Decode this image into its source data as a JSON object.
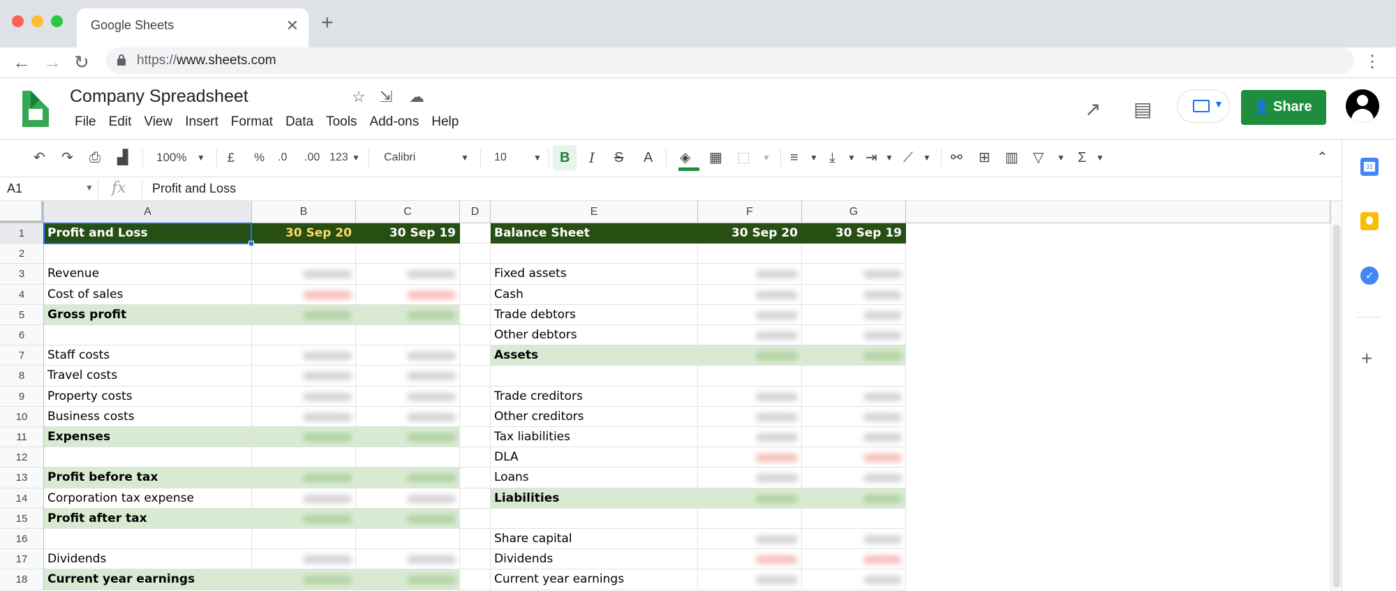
{
  "browser": {
    "tab_title": "Google Sheets",
    "url_scheme": "https://",
    "url_host": "www.sheets.com"
  },
  "doc": {
    "title": "Company Spreadsheet",
    "menu": [
      "File",
      "Edit",
      "View",
      "Insert",
      "Format",
      "Data",
      "Tools",
      "Add-ons",
      "Help"
    ],
    "share_label": "Share"
  },
  "toolbar": {
    "zoom": "100%",
    "currency": "£",
    "percent": "%",
    "dec_less": ".0",
    "dec_more": ".00",
    "number_format": "123",
    "font": "Calibri",
    "font_size": "10"
  },
  "formula_bar": {
    "cell_ref": "A1",
    "content": "Profit and Loss"
  },
  "side_panel": {
    "calendar_day": "31"
  },
  "grid": {
    "columns": [
      "A",
      "B",
      "C",
      "D",
      "E",
      "F",
      "G"
    ],
    "row_numbers": [
      "1",
      "2",
      "3",
      "4",
      "5",
      "6",
      "7",
      "8",
      "9",
      "10",
      "11",
      "12",
      "13",
      "14",
      "15",
      "16",
      "17",
      "18"
    ],
    "pl": {
      "header": "Profit and Loss",
      "col_b": "30 Sep 20",
      "col_c": "30 Sep 19",
      "rows": [
        "",
        "Revenue",
        "Cost of sales",
        "Gross profit",
        "",
        "Staff costs",
        "Travel costs",
        "Property costs",
        "Business costs",
        "Expenses",
        "",
        "Profit before tax",
        "Corporation tax expense",
        "Profit after tax",
        "",
        "Dividends",
        "Current year earnings"
      ]
    },
    "bs": {
      "header": "Balance Sheet",
      "col_f": "30 Sep 20",
      "col_g": "30 Sep 19",
      "rows": [
        "",
        "Fixed assets",
        "Cash",
        "Trade debtors",
        "Other debtors",
        "Assets",
        "",
        "Trade creditors",
        "Other creditors",
        "Tax liabilities",
        "DLA",
        "Loans",
        "Liabilities",
        "",
        "Share capital",
        "Dividends",
        "Current year earnings"
      ]
    }
  },
  "colors": {
    "header_fill": "#274e13",
    "highlight_fill": "#d9ead3",
    "selection": "#1a73e8",
    "share_button": "#1e8e3e"
  }
}
